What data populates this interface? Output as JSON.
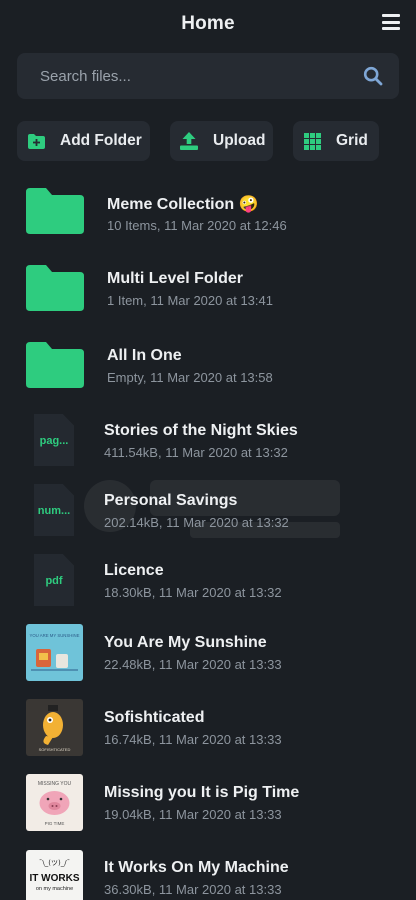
{
  "header": {
    "title": "Home",
    "menu_icon": "hamburger-menu-icon"
  },
  "search": {
    "placeholder": "Search files...",
    "value": "",
    "icon": "search-icon"
  },
  "actions": {
    "add_folder": {
      "label": "Add Folder",
      "icon": "folder-plus-icon"
    },
    "upload": {
      "label": "Upload",
      "icon": "upload-icon"
    },
    "grid": {
      "label": "Grid",
      "icon": "grid-icon"
    }
  },
  "colors": {
    "accent": "#2ecc7f",
    "background": "#1b1f24",
    "surface": "#262b32",
    "muted_text": "#8d959e"
  },
  "items": [
    {
      "type": "folder",
      "name": "Meme Collection 🤪",
      "meta": "10 Items, 11 Mar 2020 at 12:46",
      "icon": "folder-icon"
    },
    {
      "type": "folder",
      "name": "Multi Level Folder",
      "meta": "1 Item, 11 Mar 2020 at 13:41",
      "icon": "folder-icon"
    },
    {
      "type": "folder",
      "name": "All In One",
      "meta": "Empty, 11 Mar 2020 at 13:58",
      "icon": "folder-icon"
    },
    {
      "type": "document",
      "ext": "pag...",
      "name": "Stories of the Night Skies",
      "meta": "411.54kB, 11 Mar 2020 at 13:32",
      "icon": "document-icon"
    },
    {
      "type": "document",
      "ext": "num...",
      "name": "Personal Savings",
      "meta": "202.14kB, 11 Mar 2020 at 13:32",
      "icon": "document-icon"
    },
    {
      "type": "document",
      "ext": "pdf",
      "name": "Licence",
      "meta": "18.30kB, 11 Mar 2020 at 13:32",
      "icon": "document-icon"
    },
    {
      "type": "image",
      "name": "You Are My Sunshine",
      "meta": "22.48kB, 11 Mar 2020 at 13:33",
      "icon": "image-thumbnail"
    },
    {
      "type": "image",
      "name": "Sofishticated",
      "meta": "16.74kB, 11 Mar 2020 at 13:33",
      "icon": "image-thumbnail"
    },
    {
      "type": "image",
      "name": "Missing you It is Pig Time",
      "meta": "19.04kB, 11 Mar 2020 at 13:33",
      "icon": "image-thumbnail"
    },
    {
      "type": "image",
      "name": "It Works On My Machine",
      "meta": "36.30kB, 11 Mar 2020 at 13:33",
      "icon": "image-thumbnail"
    }
  ],
  "thumb_text": {
    "sunshine": "YOU ARE MY SUNSHINE",
    "sofish": "SOFISHTICATED",
    "pig_top": "MISSING YOU",
    "pig_bottom": "PIG TIME",
    "works_face": "¯\\_(ツ)_/¯",
    "works_line1": "IT WORKS",
    "works_line2": "on my machine"
  }
}
